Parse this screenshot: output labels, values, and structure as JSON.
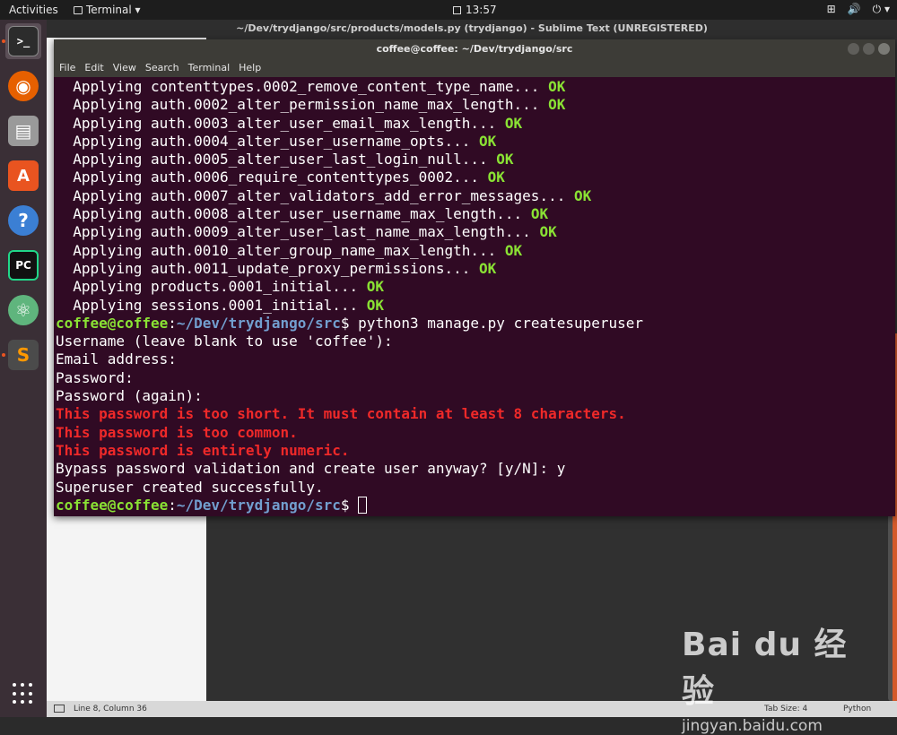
{
  "topbar": {
    "activities": "Activities",
    "app_menu": "Terminal ▾",
    "clock": "13:57",
    "tray": [
      "⊞",
      "🔊",
      "⏻ ▾"
    ]
  },
  "sublime": {
    "title": "~/Dev/trydjango/src/products/models.py (trydjango) - Sublime Text (UNREGISTERED)",
    "status_position": "Line 8, Column 36",
    "tab_size": "Tab Size: 4",
    "syntax": "Python"
  },
  "terminal": {
    "title": "coffee@coffee: ~/Dev/trydjango/src",
    "menu": [
      "File",
      "Edit",
      "View",
      "Search",
      "Terminal",
      "Help"
    ],
    "ok_text": "OK",
    "migrations": [
      "  Applying contenttypes.0002_remove_content_type_name...",
      "  Applying auth.0002_alter_permission_name_max_length...",
      "  Applying auth.0003_alter_user_email_max_length...",
      "  Applying auth.0004_alter_user_username_opts...",
      "  Applying auth.0005_alter_user_last_login_null...",
      "  Applying auth.0006_require_contenttypes_0002...",
      "  Applying auth.0007_alter_validators_add_error_messages...",
      "  Applying auth.0008_alter_user_username_max_length...",
      "  Applying auth.0009_alter_user_last_name_max_length...",
      "  Applying auth.0010_alter_group_name_max_length...",
      "  Applying auth.0011_update_proxy_permissions...",
      "  Applying products.0001_initial...",
      "  Applying sessions.0001_initial..."
    ],
    "prompt_user": "coffee@coffee",
    "prompt_sep": ":",
    "prompt_path": "~/Dev/trydjango/src",
    "prompt_dollar": "$ ",
    "command": "python3 manage.py createsuperuser",
    "username_prompt": "Username (leave blank to use 'coffee'):",
    "email_prompt": "Email address:",
    "password_prompt": "Password:",
    "password_again_prompt": "Password (again):",
    "errors": [
      "This password is too short. It must contain at least 8 characters.",
      "This password is too common.",
      "This password is entirely numeric."
    ],
    "bypass_prompt": "Bypass password validation and create user anyway? [y/N]: y",
    "success": "Superuser created successfully."
  },
  "dock": {
    "items": [
      {
        "name": "terminal",
        "glyph": ">_",
        "color": "#2c2c2c"
      },
      {
        "name": "firefox",
        "glyph": "◉",
        "color": "#e66000"
      },
      {
        "name": "files",
        "glyph": "▤",
        "color": "#9a9a9a"
      },
      {
        "name": "software",
        "glyph": "A",
        "color": "#e95420"
      },
      {
        "name": "help",
        "glyph": "?",
        "color": "#3b7fd4"
      },
      {
        "name": "pycharm",
        "glyph": "PC",
        "color": "#21d789"
      },
      {
        "name": "atom",
        "glyph": "⚛",
        "color": "#5fb57d"
      },
      {
        "name": "sublime",
        "glyph": "S",
        "color": "#4b4b4b"
      }
    ]
  },
  "watermark": {
    "logo": "Bai du 经验",
    "url": "jingyan.baidu.com"
  }
}
